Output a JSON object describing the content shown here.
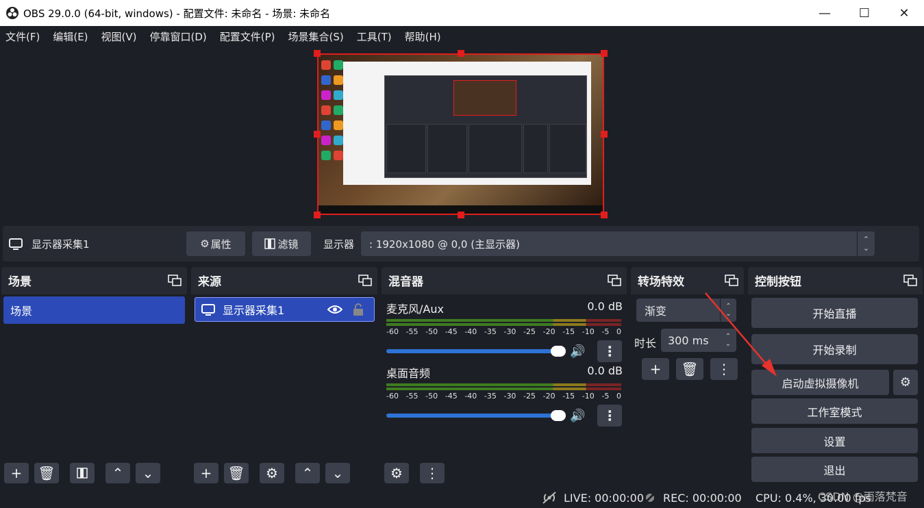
{
  "window": {
    "title": "OBS 29.0.0 (64-bit, windows) - 配置文件: 未命名 - 场景: 未命名",
    "minimize": "—",
    "maximize": "☐",
    "close": "✕"
  },
  "menu": [
    "文件(F)",
    "编辑(E)",
    "视图(V)",
    "停靠窗口(D)",
    "配置文件(P)",
    "场景集合(S)",
    "工具(T)",
    "帮助(H)"
  ],
  "source_toolbar": {
    "source_name": "显示器采集1",
    "properties_label": "属性",
    "filters_label": "滤镜",
    "display_label": "显示器",
    "display_value": ": 1920x1080 @ 0,0 (主显示器)"
  },
  "scenes": {
    "title": "场景",
    "items": [
      "场景"
    ]
  },
  "sources": {
    "title": "来源",
    "items": [
      "显示器采集1"
    ]
  },
  "mixer": {
    "title": "混音器",
    "scale": [
      "-60",
      "-55",
      "-50",
      "-45",
      "-40",
      "-35",
      "-30",
      "-25",
      "-20",
      "-15",
      "-10",
      "-5",
      "0"
    ],
    "channels": [
      {
        "name": "麦克风/Aux",
        "db": "0.0 dB"
      },
      {
        "name": "桌面音频",
        "db": "0.0 dB"
      }
    ]
  },
  "transitions": {
    "title": "转场特效",
    "type": "渐变",
    "duration_label": "时长",
    "duration_value": "300 ms"
  },
  "controls": {
    "title": "控制按钮",
    "start_streaming": "开始直播",
    "start_recording": "开始录制",
    "start_virtual_camera": "启动虚拟摄像机",
    "studio_mode": "工作室模式",
    "settings": "设置",
    "exit": "退出"
  },
  "status": {
    "live": "LIVE: 00:00:00",
    "rec": "REC: 00:00:00",
    "cpu": "CPU: 0.4%, 30.00 fps",
    "watermark": "CSDN @雨落梵音"
  },
  "colors": {
    "accent_selected": "#2c4bb8",
    "selection_border": "#e11d1d",
    "annotation_arrow": "#e8322c"
  }
}
